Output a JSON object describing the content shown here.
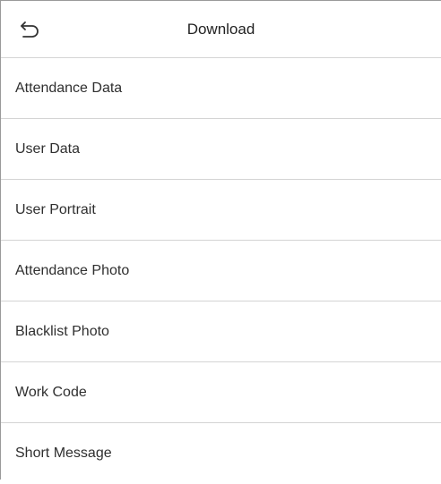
{
  "header": {
    "title": "Download",
    "back_icon": "back-arrow-icon"
  },
  "menu": {
    "items": [
      {
        "label": "Attendance Data"
      },
      {
        "label": "User Data"
      },
      {
        "label": "User Portrait"
      },
      {
        "label": "Attendance Photo"
      },
      {
        "label": "Blacklist Photo"
      },
      {
        "label": "Work Code"
      },
      {
        "label": "Short Message"
      }
    ]
  },
  "colors": {
    "background": "#ffffff",
    "divider": "#d4d4d4",
    "text": "#2f2f2f"
  }
}
